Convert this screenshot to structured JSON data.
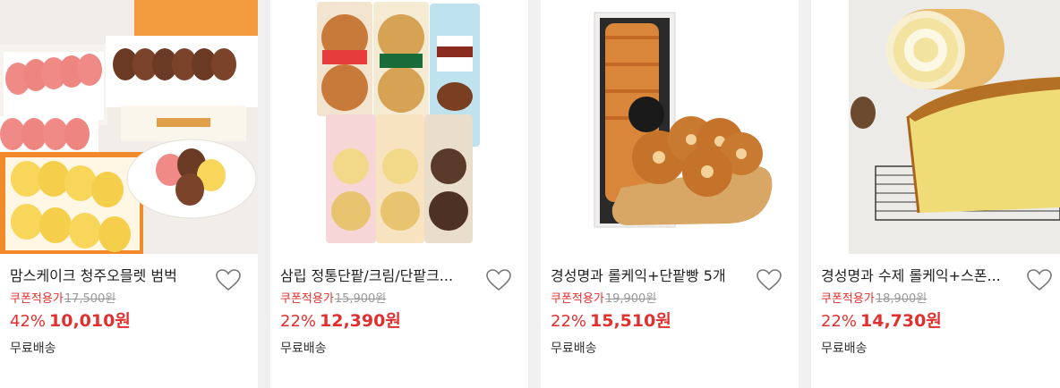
{
  "colors": {
    "accent": "#e0302f",
    "muted": "#999999"
  },
  "products": [
    {
      "title": "맘스케이크 청주오믈렛 범벅",
      "coupon_label": "쿠폰적용가",
      "original_price": "17,500원",
      "discount": "42%",
      "price": "10,010원",
      "shipping": "무료배송",
      "heart_icon": "heart-outline-icon"
    },
    {
      "title": "삼립 정통단팥/크림/단팥크...",
      "coupon_label": "쿠폰적용가",
      "original_price": "15,900원",
      "discount": "22%",
      "price": "12,390원",
      "shipping": "무료배송",
      "heart_icon": "heart-outline-icon"
    },
    {
      "title": "경성명과 롤케익+단팥빵 5개",
      "coupon_label": "쿠폰적용가",
      "original_price": "19,900원",
      "discount": "22%",
      "price": "15,510원",
      "shipping": "무료배송",
      "heart_icon": "heart-outline-icon"
    },
    {
      "title": "경성명과 수제 롤케익+스폰...",
      "coupon_label": "쿠폰적용가",
      "original_price": "18,900원",
      "discount": "22%",
      "price": "14,730원",
      "shipping": "무료배송",
      "heart_icon": "heart-outline-icon"
    }
  ]
}
